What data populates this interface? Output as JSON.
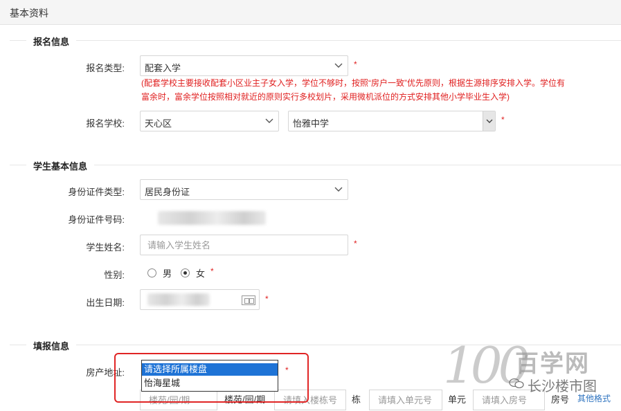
{
  "header": {
    "title": "基本资料"
  },
  "sections": {
    "registration": "报名信息",
    "student": "学生基本信息",
    "fill": "填报信息"
  },
  "registration": {
    "type_label": "报名类型:",
    "type_value": "配套入学",
    "hint_line1": "(配套学校主要接收配套小区业主子女入学，学位不够时，按照“房户一致”优先原则，根据生源排序安排入学。学位有",
    "hint_line2": "富余时，富余学位按照相对就近的原则实行多校划片，采用微机派位的方式安排其他小学毕业生入学)",
    "school_label": "报名学校:",
    "district_value": "天心区",
    "school_value": "怡雅中学"
  },
  "student": {
    "id_type_label": "身份证件类型:",
    "id_type_value": "居民身份证",
    "id_number_label": "身份证件号码:",
    "name_label": "学生姓名:",
    "name_placeholder": "请输入学生姓名",
    "gender_label": "性别:",
    "gender_male": "男",
    "gender_female": "女",
    "gender_selected": "女",
    "birth_label": "出生日期:"
  },
  "fill": {
    "property_label": "房产地址:",
    "dropdown_options": [
      "请选择所属楼盘",
      "怡海星城"
    ],
    "dropdown_selected": "请选择所属楼盘",
    "estate_placeholder": "楼苑/园/期",
    "estate_suffix": "楼苑/园/期",
    "building_placeholder": "请填入楼栋号",
    "building_suffix": "栋",
    "unit_placeholder": "请填入单元号",
    "unit_suffix": "单元",
    "room_placeholder": "请填入房号",
    "room_suffix": "房号",
    "other_link": "其他格式"
  },
  "required_mark": "*",
  "watermark": {
    "number": "100",
    "brand": "百学网",
    "account": "长沙楼市图"
  },
  "colors": {
    "required": "#e02020",
    "selection": "#1e73d6",
    "highlight_frame": "#e02424",
    "link": "#2f74c0"
  }
}
